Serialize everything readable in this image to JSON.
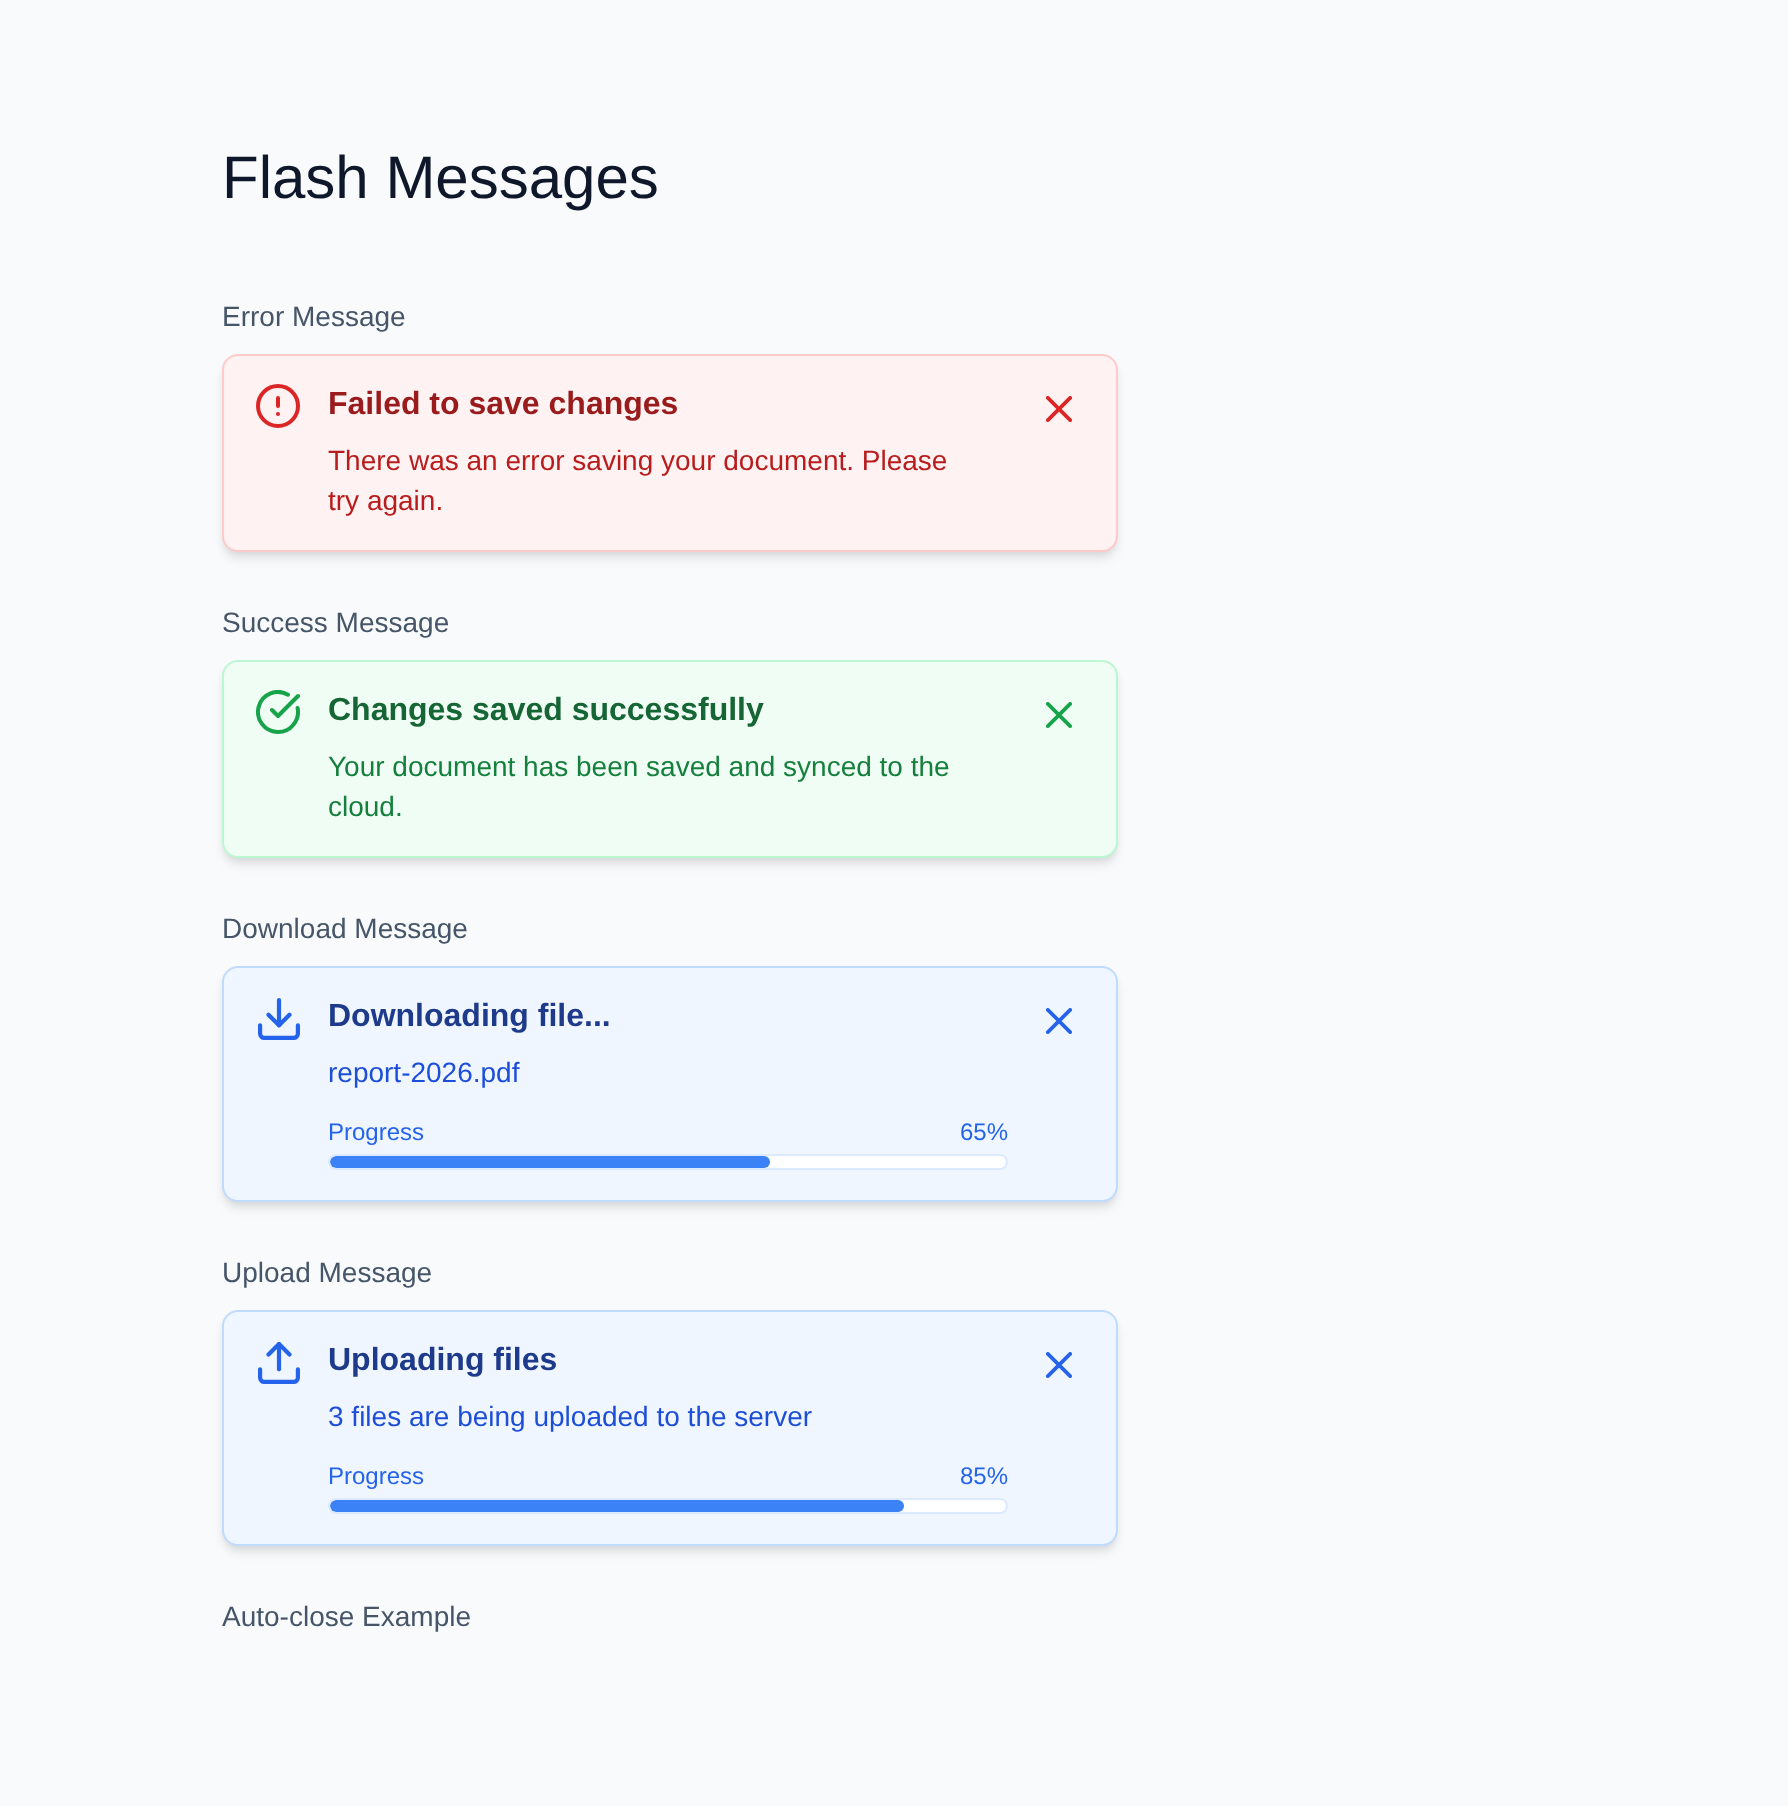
{
  "page": {
    "title": "Flash Messages"
  },
  "sections": [
    {
      "label": "Error Message",
      "message": {
        "kind": "error",
        "title": "Failed to save changes",
        "body": "There was an error saving your document. Please try again."
      }
    },
    {
      "label": "Success Message",
      "message": {
        "kind": "success",
        "title": "Changes saved successfully",
        "body": "Your document has been saved and synced to the cloud."
      }
    },
    {
      "label": "Download Message",
      "message": {
        "kind": "download",
        "title": "Downloading file...",
        "body": "report-2026.pdf",
        "progress": {
          "label": "Progress",
          "reading": "65%",
          "level": 0.65
        }
      }
    },
    {
      "label": "Upload Message",
      "message": {
        "kind": "upload",
        "title": "Uploading files",
        "body": "3 files are being uploaded to the server",
        "progress": {
          "label": "Progress",
          "reading": "85%",
          "level": 0.85
        }
      }
    },
    {
      "label": "Auto-close Example"
    }
  ]
}
